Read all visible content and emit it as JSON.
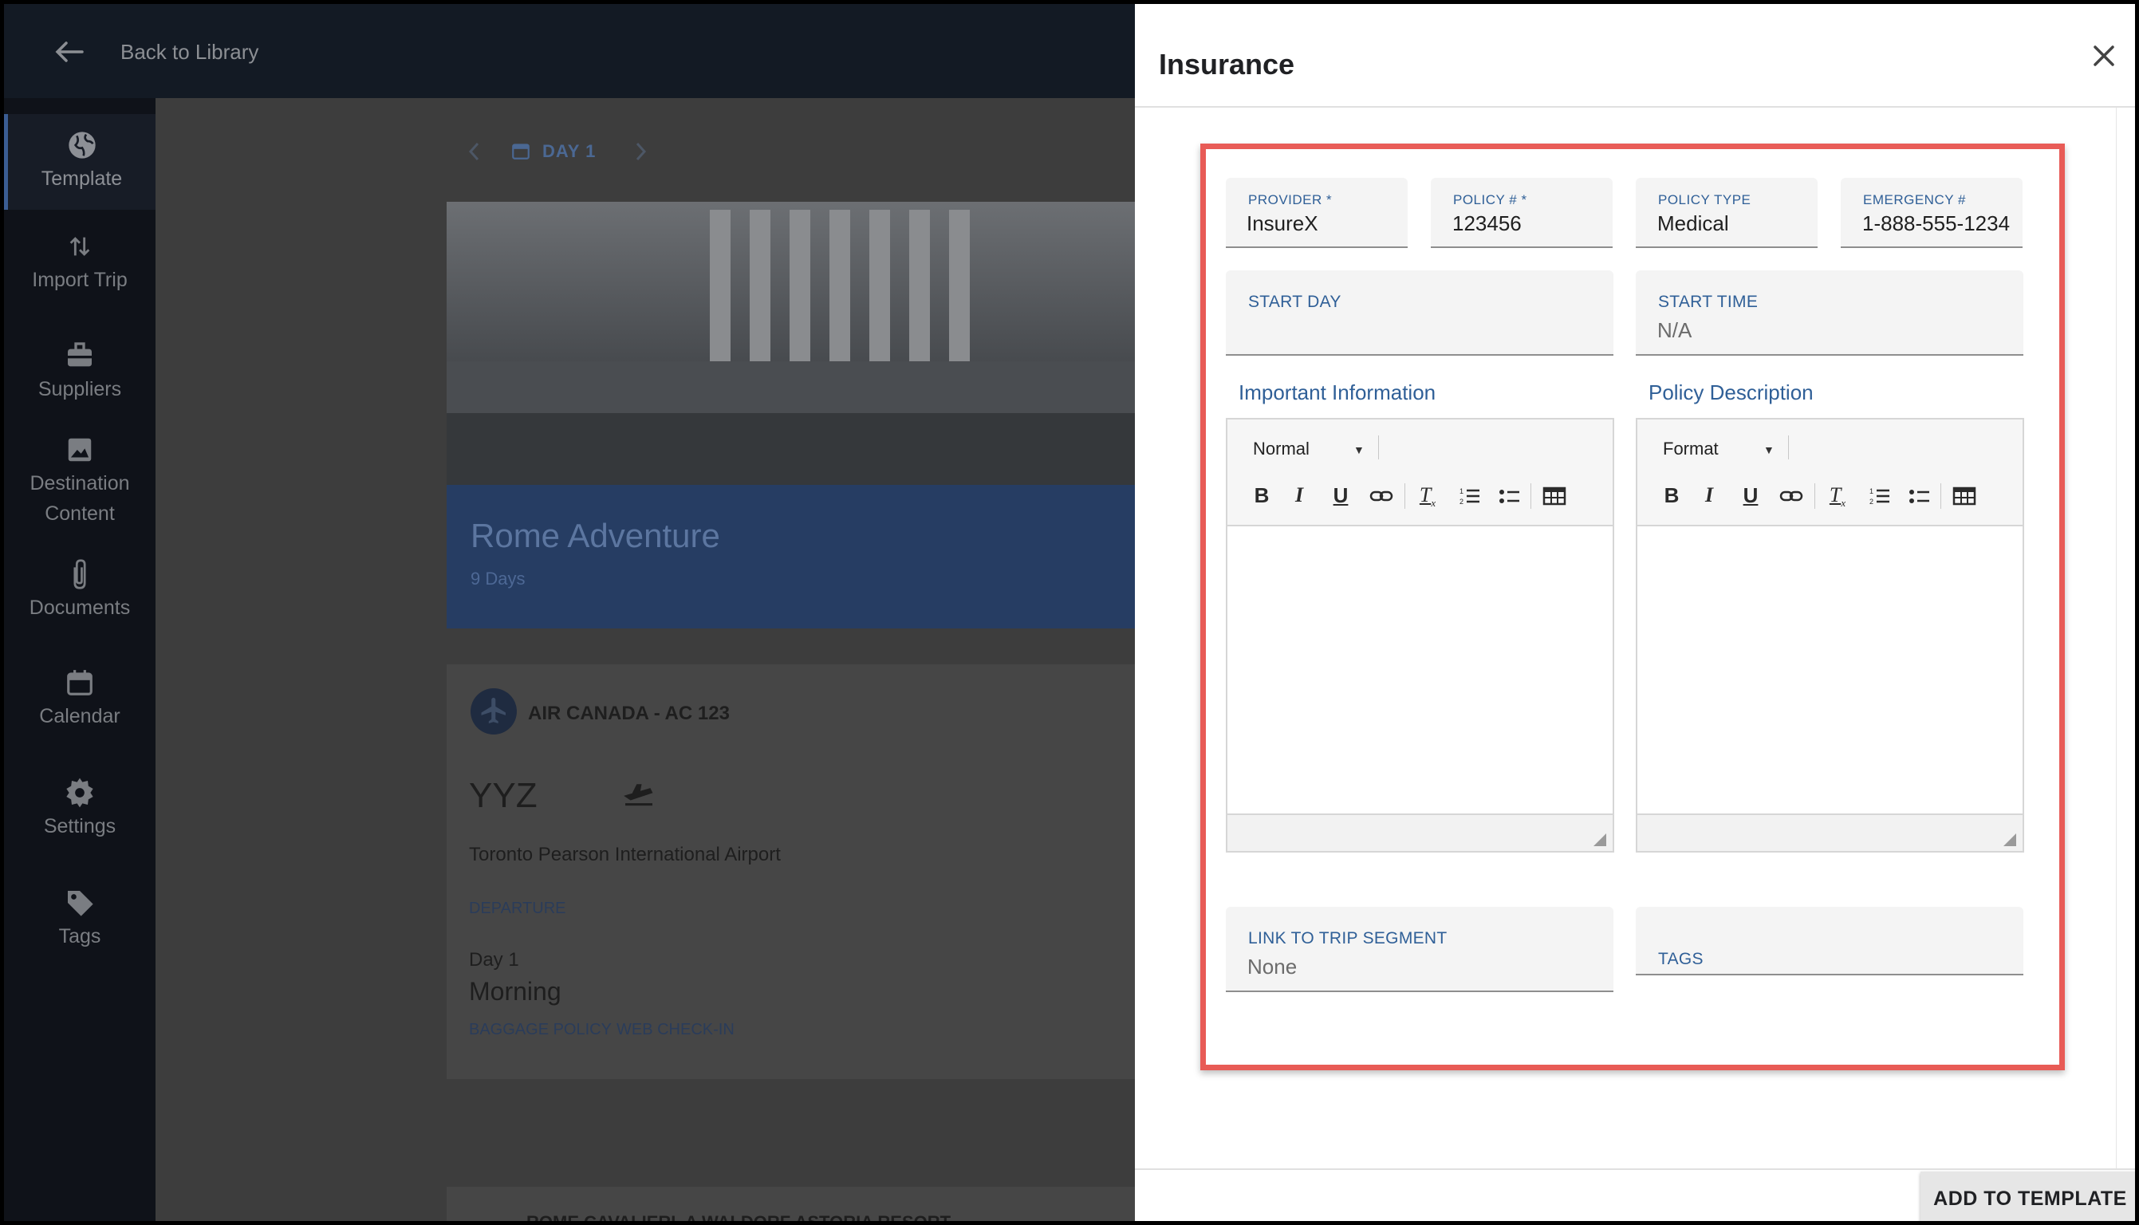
{
  "app": {
    "back_label": "Back to Library",
    "sidebar": [
      {
        "label": "Template",
        "icon": "globe-icon"
      },
      {
        "label": "Import Trip",
        "icon": "import-arrows-icon"
      },
      {
        "label": "Suppliers",
        "icon": "briefcase-icon"
      },
      {
        "label": "Destination",
        "label2": "Content",
        "icon": "image-icon"
      },
      {
        "label": "Documents",
        "icon": "paperclip-icon"
      },
      {
        "label": "Calendar",
        "icon": "calendar-icon"
      },
      {
        "label": "Settings",
        "icon": "gear-icon"
      },
      {
        "label": "Tags",
        "icon": "tag-icon"
      }
    ],
    "day_nav": "DAY 1",
    "trip_title": "Rome Adventure",
    "trip_days": "9 Days",
    "flight": {
      "carrier": "AIR CANADA - AC 123",
      "code": "YYZ",
      "airport": "Toronto Pearson International Airport",
      "departure_label": "DEPARTURE",
      "day": "Day 1",
      "time_of_day": "Morning",
      "link1": "BAGGAGE POLICY",
      "link2": "WEB CHECK-IN"
    },
    "next_card_title": "ROME CAVALIERI, A WALDORF ASTORIA RESORT"
  },
  "drawer": {
    "title": "Insurance",
    "fields": {
      "provider_label": "PROVIDER *",
      "provider_value": "InsureX",
      "policy_label": "POLICY # *",
      "policy_value": "123456",
      "policy_type_label": "POLICY TYPE",
      "policy_type_value": "Medical",
      "emergency_label": "EMERGENCY #",
      "emergency_value": "1-888-555-1234",
      "start_day_label": "START DAY",
      "start_time_label": "START TIME",
      "start_time_value": "N/A",
      "link_label": "LINK TO TRIP SEGMENT",
      "link_value": "None",
      "tags_label": "TAGS"
    },
    "important_info": {
      "heading": "Important Information",
      "format": "Normal"
    },
    "policy_desc": {
      "heading": "Policy Description",
      "format": "Format"
    },
    "add_button": "ADD TO TEMPLATE"
  },
  "colors": {
    "accent": "#2f5f97",
    "highlight": "#e85b56",
    "sidebar": "#0f1219"
  }
}
